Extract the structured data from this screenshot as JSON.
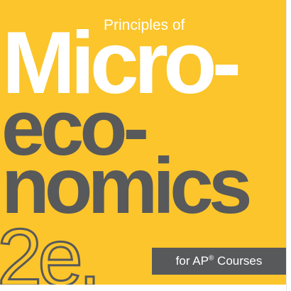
{
  "cover": {
    "background_color": "#fbc52b",
    "accent_gray": "#58595b",
    "subtitle": "Principles of",
    "title_line1": "Micro-",
    "title_line2": "eco-",
    "title_line3": "nomics",
    "edition": "2e.",
    "ap_badge": {
      "prefix": "for AP",
      "registered": "®",
      "suffix": " Courses"
    }
  }
}
